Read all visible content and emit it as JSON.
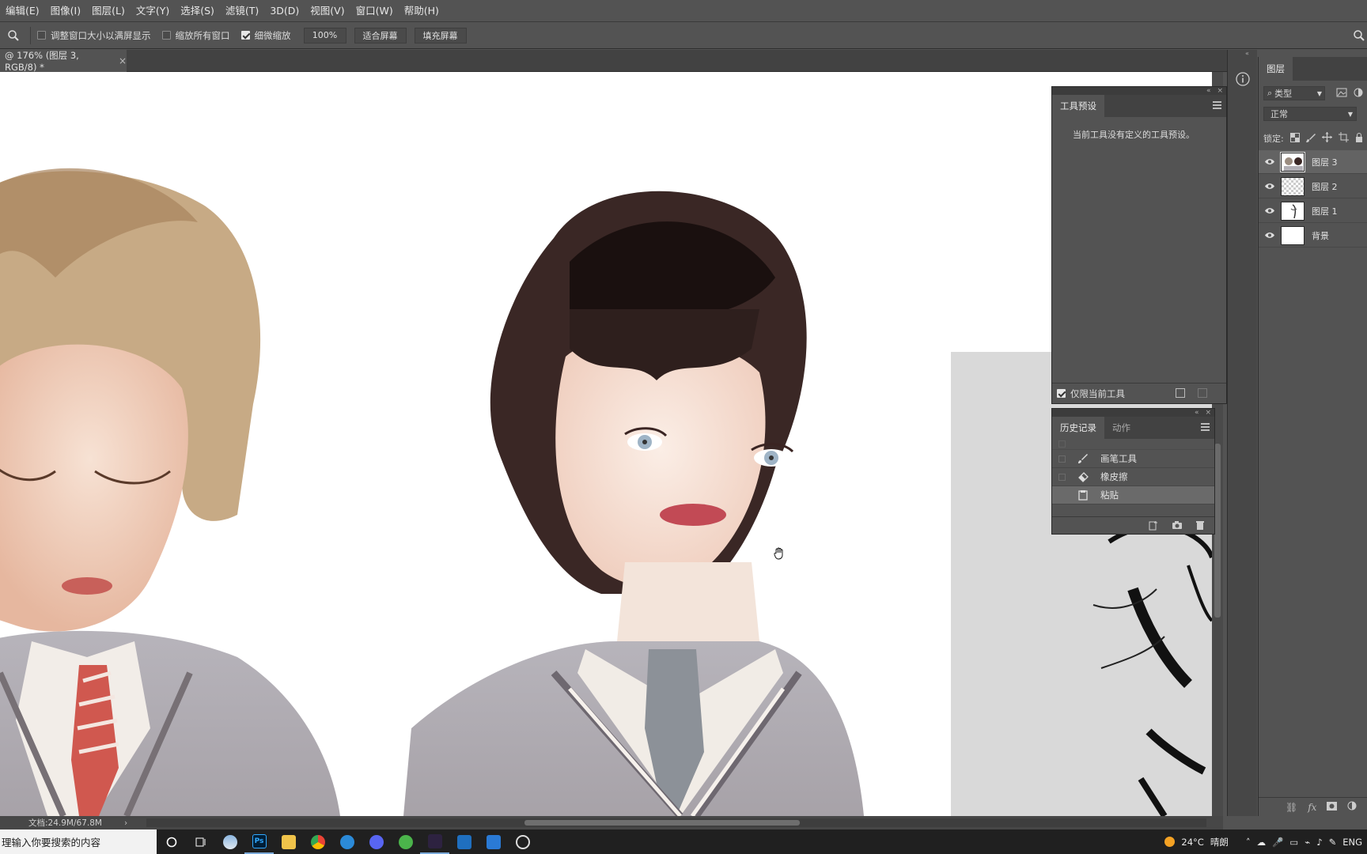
{
  "menubar": {
    "items": [
      "编辑(E)",
      "图像(I)",
      "图层(L)",
      "文字(Y)",
      "选择(S)",
      "滤镜(T)",
      "3D(D)",
      "视图(V)",
      "窗口(W)",
      "帮助(H)"
    ]
  },
  "options": {
    "resize_windows": "调整窗口大小以满屏显示",
    "resize_windows_checked": false,
    "zoom_all": "缩放所有窗口",
    "zoom_all_checked": false,
    "scrubby_zoom": "细微缩放",
    "scrubby_zoom_checked": true,
    "zoom_value": "100%",
    "fit_screen": "适合屏幕",
    "fill_screen": "填充屏幕"
  },
  "document": {
    "tab_title": "@ 176% (图层 3, RGB/8) *",
    "close": "×",
    "status": "文档:24.9M/67.8M"
  },
  "presets_panel": {
    "tab": "工具预设",
    "message": "当前工具没有定义的工具预设。",
    "current_tool_only": "仅限当前工具",
    "current_tool_only_checked": true
  },
  "history_panel": {
    "tabs": [
      "历史记录",
      "动作"
    ],
    "items": [
      {
        "label": "画笔工具",
        "icon": "brush-icon",
        "selected": false
      },
      {
        "label": "橡皮擦",
        "icon": "eraser-icon",
        "selected": false
      },
      {
        "label": "粘贴",
        "icon": "paste-icon",
        "selected": true
      }
    ]
  },
  "layers_panel": {
    "tab": "图层",
    "filter": "类型",
    "blend_mode": "正常",
    "lock_label": "锁定:",
    "layers": [
      {
        "name": "图层 3",
        "visible": true,
        "selected": true,
        "thumb": "portrait"
      },
      {
        "name": "图层 2",
        "visible": true,
        "selected": false,
        "thumb": "transparent"
      },
      {
        "name": "图层 1",
        "visible": true,
        "selected": false,
        "thumb": "sketch"
      },
      {
        "name": "背景",
        "visible": true,
        "selected": false,
        "thumb": "white"
      }
    ],
    "footer_fx": "fx"
  },
  "taskbar": {
    "search_placeholder": "理输入你要搜索的内容",
    "weather_temp": "24°C",
    "weather_desc": "晴朗",
    "lang": "ENG"
  },
  "colors": {
    "ui_bg": "#535353",
    "canvas": "#ffffff",
    "taskbar": "#202020",
    "selection": "#636363"
  }
}
